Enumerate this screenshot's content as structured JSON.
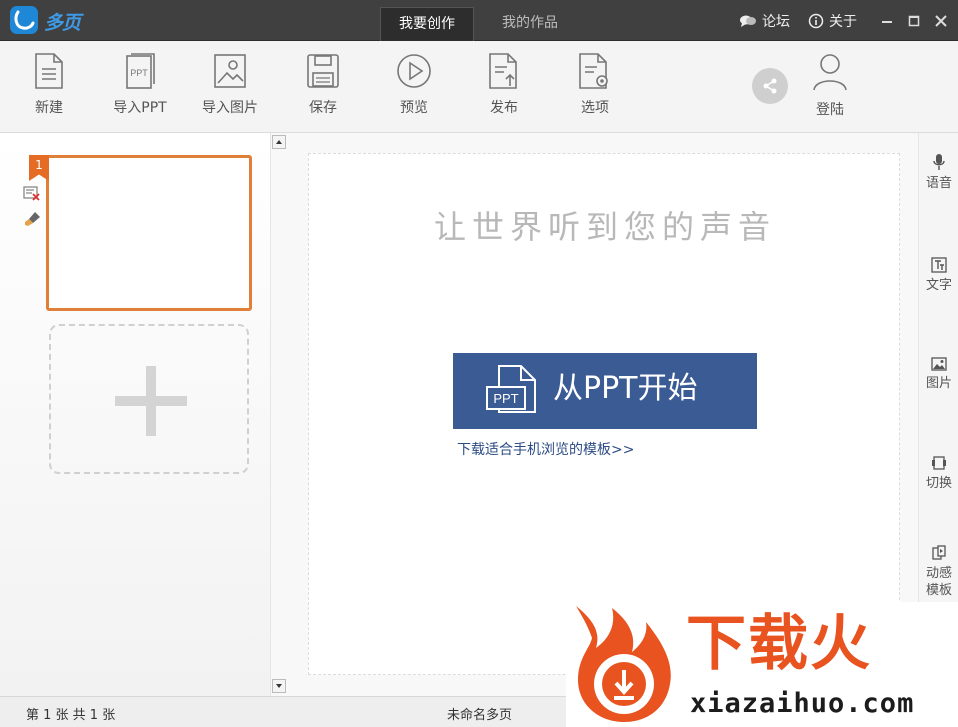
{
  "app": {
    "name": "多页"
  },
  "tabs": [
    {
      "label": "我要创作",
      "active": true
    },
    {
      "label": "我的作品",
      "active": false
    }
  ],
  "title_links": {
    "forum": "论坛",
    "about": "关于"
  },
  "toolbar": {
    "items": [
      {
        "label": "新建",
        "icon": "new-document-icon"
      },
      {
        "label": "导入PPT",
        "icon": "ppt-file-icon"
      },
      {
        "label": "导入图片",
        "icon": "image-icon"
      },
      {
        "label": "保存",
        "icon": "floppy-disk-icon"
      },
      {
        "label": "预览",
        "icon": "play-circle-icon"
      },
      {
        "label": "发布",
        "icon": "publish-document-icon"
      },
      {
        "label": "选项",
        "icon": "settings-document-icon"
      }
    ],
    "share_icon": "share-icon",
    "login_label": "登陆"
  },
  "slides": {
    "items": [
      {
        "number": "1"
      }
    ]
  },
  "canvas": {
    "headline": "让世界听到您的声音",
    "ppt_button_label": "从PPT开始",
    "ppt_icon_text": "PPT",
    "template_link": "下载适合手机浏览的模板>>"
  },
  "right_panel": {
    "items": [
      {
        "label": "语音",
        "icon": "microphone-icon"
      },
      {
        "label": "文字",
        "icon": "text-icon"
      },
      {
        "label": "图片",
        "icon": "picture-icon"
      },
      {
        "label": "切换",
        "icon": "transition-icon"
      },
      {
        "label": "动感模板",
        "icon": "motion-template-icon"
      }
    ]
  },
  "status": {
    "pages": "第 1 张  共 1 张",
    "doc_name": "未命名多页"
  },
  "watermark": {
    "title": "下载火",
    "url": "xiazaihuo.com"
  },
  "colors": {
    "titlebar": "#404040",
    "accent_orange": "#e08038",
    "ppt_button": "#3a5b93",
    "logo_blue": "#1e88d6",
    "watermark_orange": "#e8531f"
  }
}
